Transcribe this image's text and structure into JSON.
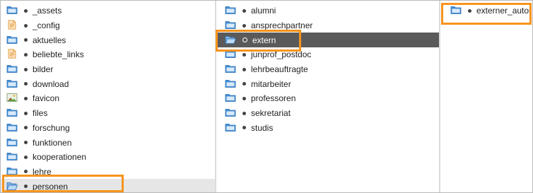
{
  "columns": [
    {
      "items": [
        {
          "label": "_assets",
          "icon": "folder-icon"
        },
        {
          "label": "_config",
          "icon": "file-icon"
        },
        {
          "label": "aktuelles",
          "icon": "folder-icon"
        },
        {
          "label": "beliebte_links",
          "icon": "file-icon"
        },
        {
          "label": "bilder",
          "icon": "folder-icon"
        },
        {
          "label": "download",
          "icon": "folder-icon"
        },
        {
          "label": "favicon",
          "icon": "image-icon"
        },
        {
          "label": "files",
          "icon": "folder-icon"
        },
        {
          "label": "forschung",
          "icon": "folder-icon"
        },
        {
          "label": "funktionen",
          "icon": "folder-icon"
        },
        {
          "label": "kooperationen",
          "icon": "folder-icon"
        },
        {
          "label": "lehre",
          "icon": "folder-icon"
        },
        {
          "label": "personen",
          "icon": "folder-icon",
          "state": "active-path"
        }
      ]
    },
    {
      "items": [
        {
          "label": "alumni",
          "icon": "folder-icon"
        },
        {
          "label": "ansprechpartner",
          "icon": "folder-icon"
        },
        {
          "label": "extern",
          "icon": "folder-icon",
          "state": "selected"
        },
        {
          "label": "junprof_postdoc",
          "icon": "folder-icon"
        },
        {
          "label": "lehrbeauftragte",
          "icon": "folder-icon"
        },
        {
          "label": "mitarbeiter",
          "icon": "folder-icon"
        },
        {
          "label": "professoren",
          "icon": "folder-icon"
        },
        {
          "label": "sekretariat",
          "icon": "folder-icon"
        },
        {
          "label": "studis",
          "icon": "folder-icon"
        }
      ]
    },
    {
      "items": [
        {
          "label": "externer_autor",
          "icon": "folder-icon"
        }
      ]
    }
  ],
  "colors": {
    "highlight": "#f7941d",
    "selected_row": "#5a5a5a",
    "active_path_row": "#e6e6e6",
    "folder_blue": "#3f8fd6"
  }
}
